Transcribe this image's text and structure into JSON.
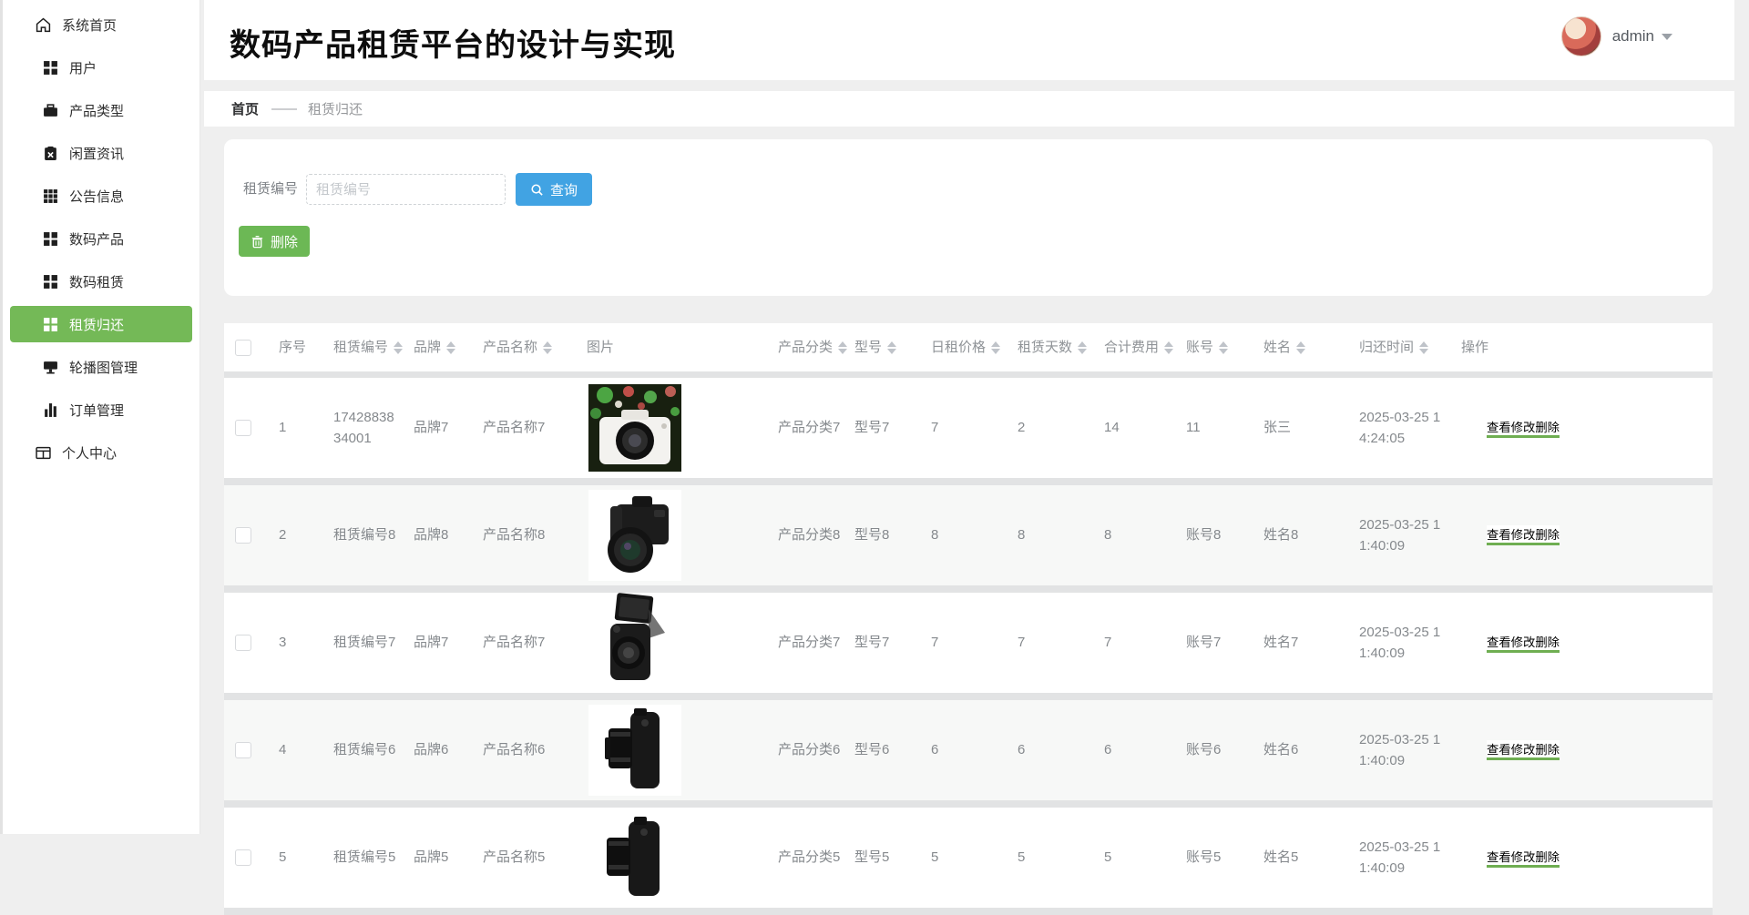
{
  "app": {
    "title": "数码产品租赁平台的设计与实现"
  },
  "user": {
    "name": "admin"
  },
  "sidebar": {
    "items": [
      {
        "label": "系统首页"
      },
      {
        "label": "用户"
      },
      {
        "label": "产品类型"
      },
      {
        "label": "闲置资讯"
      },
      {
        "label": "公告信息"
      },
      {
        "label": "数码产品"
      },
      {
        "label": "数码租赁"
      },
      {
        "label": "租赁归还"
      },
      {
        "label": "轮播图管理"
      },
      {
        "label": "订单管理"
      },
      {
        "label": "个人中心"
      }
    ]
  },
  "breadcrumb": {
    "home": "首页",
    "separator": "——",
    "current": "租赁归还"
  },
  "filter": {
    "label": "租赁编号",
    "input_value": "",
    "input_placeholder": "租赁编号",
    "search_button": "查询",
    "delete_button": "删除"
  },
  "table": {
    "columns": [
      {
        "label": "序号",
        "sortable": false
      },
      {
        "label": "租赁编号",
        "sortable": true
      },
      {
        "label": "品牌",
        "sortable": true
      },
      {
        "label": "产品名称",
        "sortable": true
      },
      {
        "label": "图片",
        "sortable": false
      },
      {
        "label": "产品分类",
        "sortable": true
      },
      {
        "label": "型号",
        "sortable": true
      },
      {
        "label": "日租价格",
        "sortable": true
      },
      {
        "label": "租赁天数",
        "sortable": true
      },
      {
        "label": "合计费用",
        "sortable": true
      },
      {
        "label": "账号",
        "sortable": true
      },
      {
        "label": "姓名",
        "sortable": true
      },
      {
        "label": "归还时间",
        "sortable": true
      },
      {
        "label": "操作",
        "sortable": false
      }
    ],
    "actions": {
      "view": "查看",
      "edit": "修改",
      "delete": "删除"
    },
    "rows": [
      {
        "seq": "1",
        "rental_no": "1742883834001",
        "brand": "品牌7",
        "product_name": "产品名称7",
        "image": "white-camera-bokeh",
        "category": "产品分类7",
        "model": "型号7",
        "daily_price": "7",
        "rent_days": "2",
        "total_fee": "14",
        "account": "11",
        "real_name": "张三",
        "return_time": "2025-03-25 14:24:05"
      },
      {
        "seq": "2",
        "rental_no": "租赁编号8",
        "brand": "品牌8",
        "product_name": "产品名称8",
        "image": "black-bridge-camera",
        "category": "产品分类8",
        "model": "型号8",
        "daily_price": "8",
        "rent_days": "8",
        "total_fee": "8",
        "account": "账号8",
        "real_name": "姓名8",
        "return_time": "2025-03-25 11:40:09"
      },
      {
        "seq": "3",
        "rental_no": "租赁编号7",
        "brand": "品牌7",
        "product_name": "产品名称7",
        "image": "flip-screen-camera",
        "category": "产品分类7",
        "model": "型号7",
        "daily_price": "7",
        "rent_days": "7",
        "total_fee": "7",
        "account": "账号7",
        "real_name": "姓名7",
        "return_time": "2025-03-25 11:40:09"
      },
      {
        "seq": "4",
        "rental_no": "租赁编号6",
        "brand": "品牌6",
        "product_name": "产品名称6",
        "image": "black-dslr-side",
        "category": "产品分类6",
        "model": "型号6",
        "daily_price": "6",
        "rent_days": "6",
        "total_fee": "6",
        "account": "账号6",
        "real_name": "姓名6",
        "return_time": "2025-03-25 11:40:09"
      },
      {
        "seq": "5",
        "rental_no": "租赁编号5",
        "brand": "品牌5",
        "product_name": "产品名称5",
        "image": "black-dslr-side",
        "category": "产品分类5",
        "model": "型号5",
        "daily_price": "5",
        "rent_days": "5",
        "total_fee": "5",
        "account": "账号5",
        "real_name": "姓名5",
        "return_time": "2025-03-25 11:40:09"
      }
    ]
  },
  "colors": {
    "sidebar_active_green": "#74b957",
    "button_blue": "#41a3e3",
    "button_green": "#6cb855",
    "action_link_green": "#5ea345"
  }
}
